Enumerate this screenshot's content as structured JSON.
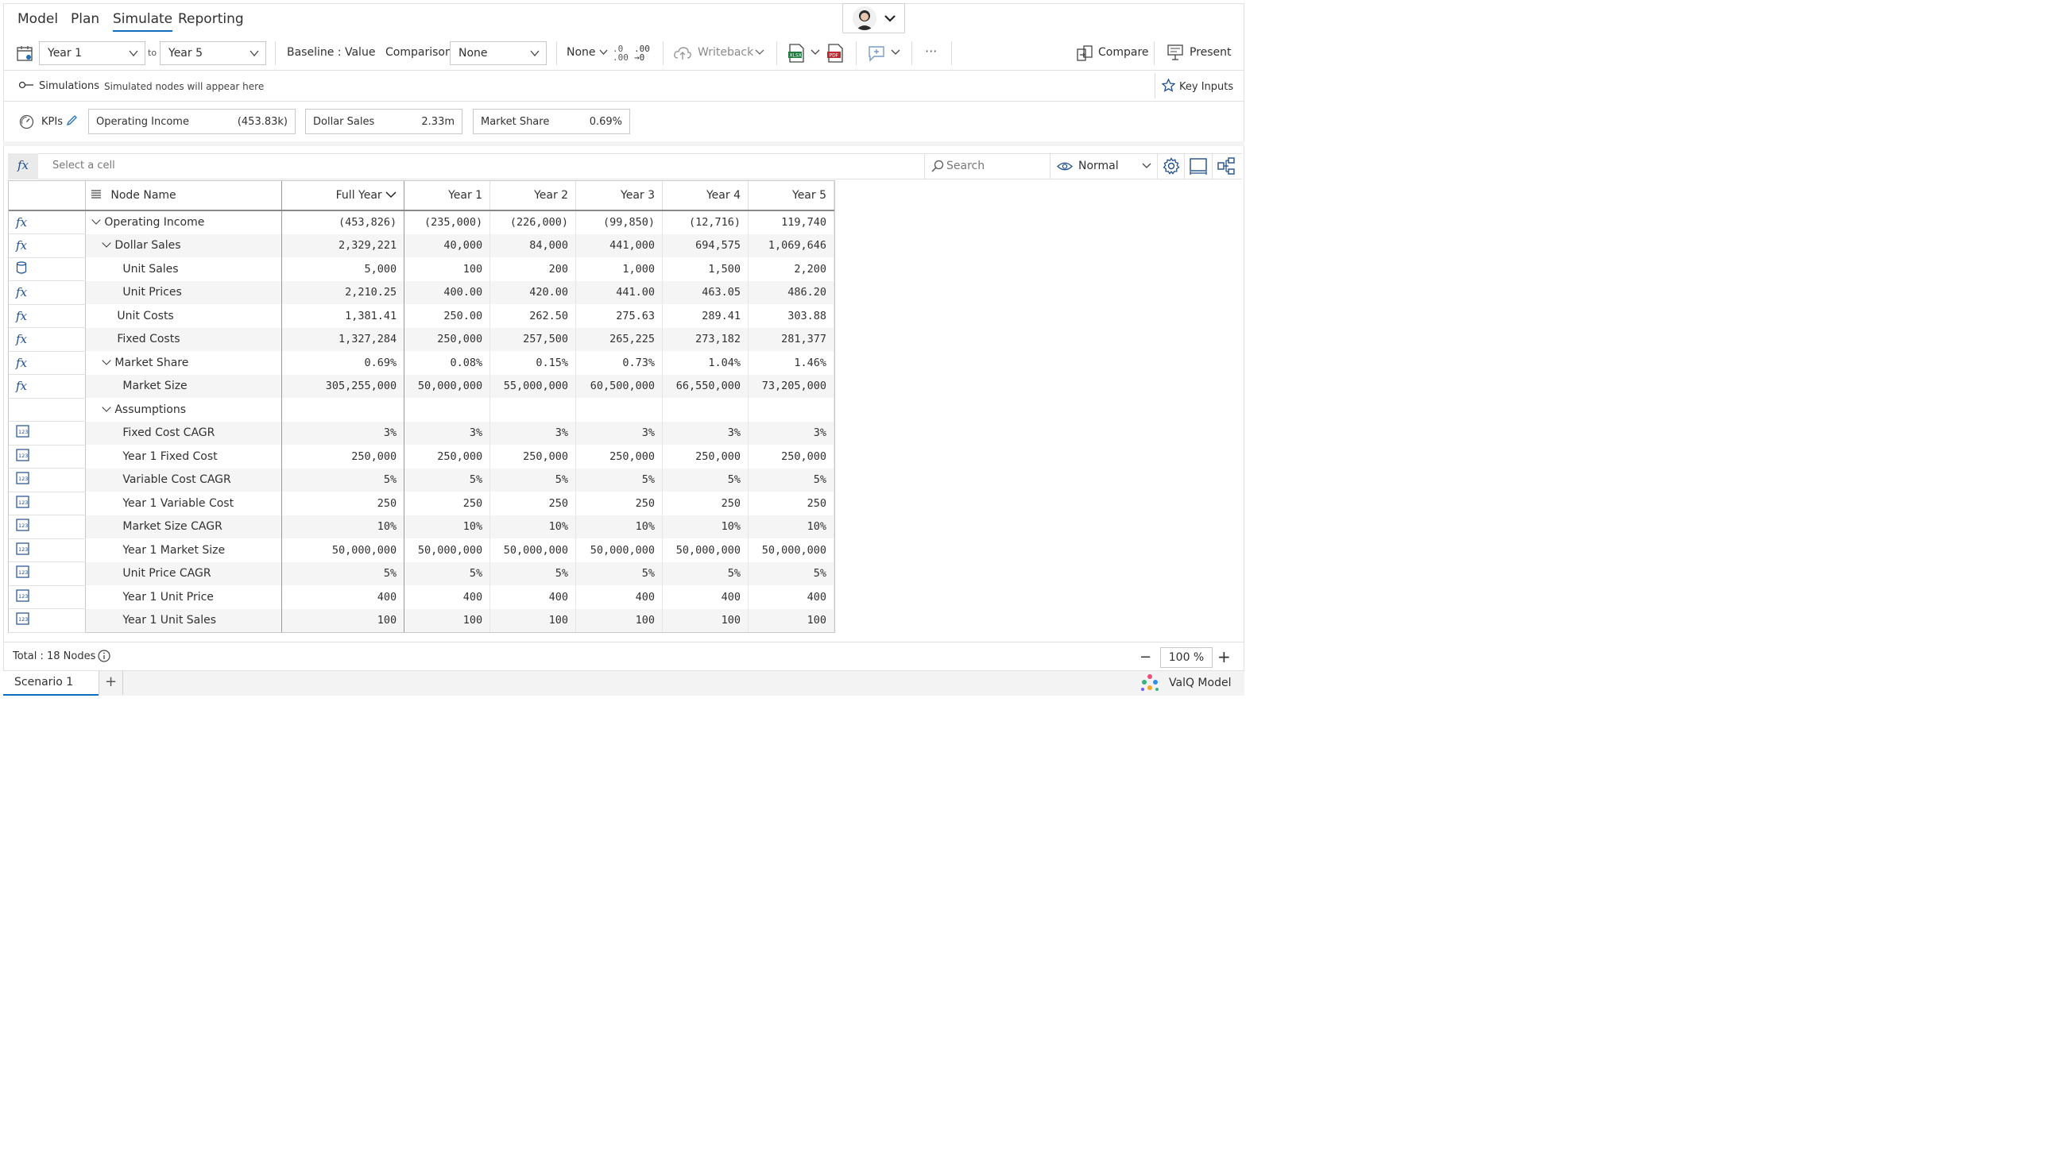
{
  "nav": {
    "tabs": [
      "Model",
      "Plan",
      "Simulate",
      "Reporting"
    ],
    "active": "Simulate"
  },
  "toolbar": {
    "from_year": "Year 1",
    "to_label": "to",
    "to_year": "Year 5",
    "baseline_label": "Baseline",
    "baseline_value": "Value",
    "comparison_label": "Comparison",
    "comparison_value": "None",
    "number_format": "None",
    "decimals_less": ".0",
    "decimals_more": ".00",
    "writeback_label": "Writeback",
    "more_label": "···",
    "compare_label": "Compare",
    "present_label": "Present"
  },
  "simulations": {
    "label": "Simulations",
    "hint": "Simulated nodes will appear here",
    "key_inputs_label": "Key Inputs"
  },
  "kpis": {
    "label": "KPIs",
    "cards": [
      {
        "name": "Operating Income",
        "value": "(453.83k)"
      },
      {
        "name": "Dollar Sales",
        "value": "2.33m"
      },
      {
        "name": "Market Share",
        "value": "0.69%"
      }
    ]
  },
  "formula_bar": {
    "fx": "fx",
    "placeholder": "Select a cell",
    "search_placeholder": "Search",
    "view_mode": "Normal"
  },
  "grid": {
    "node_name_header": "Node Name",
    "columns": [
      "Full Year",
      "Year 1",
      "Year 2",
      "Year 3",
      "Year 4",
      "Year 5"
    ],
    "rows": [
      {
        "icon": "fx",
        "name": "Operating Income",
        "indent": 0,
        "expand": true,
        "values": [
          "(453,826)",
          "(235,000)",
          "(226,000)",
          "(99,850)",
          "(12,716)",
          "119,740"
        ]
      },
      {
        "icon": "fx",
        "name": "Dollar Sales",
        "indent": 1,
        "expand": true,
        "values": [
          "2,329,221",
          "40,000",
          "84,000",
          "441,000",
          "694,575",
          "1,069,646"
        ]
      },
      {
        "icon": "db",
        "name": "Unit Sales",
        "indent": 2,
        "expand": false,
        "values": [
          "5,000",
          "100",
          "200",
          "1,000",
          "1,500",
          "2,200"
        ]
      },
      {
        "icon": "fx",
        "name": "Unit Prices",
        "indent": 2,
        "expand": false,
        "values": [
          "2,210.25",
          "400.00",
          "420.00",
          "441.00",
          "463.05",
          "486.20"
        ]
      },
      {
        "icon": "fx",
        "name": "Unit Costs",
        "indent": 1,
        "expand": false,
        "values": [
          "1,381.41",
          "250.00",
          "262.50",
          "275.63",
          "289.41",
          "303.88"
        ]
      },
      {
        "icon": "fx",
        "name": "Fixed Costs",
        "indent": 1,
        "expand": false,
        "values": [
          "1,327,284",
          "250,000",
          "257,500",
          "265,225",
          "273,182",
          "281,377"
        ]
      },
      {
        "icon": "fx",
        "name": "Market Share",
        "indent": 1,
        "expand": true,
        "values": [
          "0.69%",
          "0.08%",
          "0.15%",
          "0.73%",
          "1.04%",
          "1.46%"
        ]
      },
      {
        "icon": "fx",
        "name": "Market Size",
        "indent": 2,
        "expand": false,
        "values": [
          "305,255,000",
          "50,000,000",
          "55,000,000",
          "60,500,000",
          "66,550,000",
          "73,205,000"
        ]
      },
      {
        "icon": "none",
        "name": "Assumptions",
        "indent": 1,
        "expand": true,
        "values": [
          "",
          "",
          "",
          "",
          "",
          ""
        ]
      },
      {
        "icon": "123",
        "name": "Fixed Cost CAGR",
        "indent": 2,
        "expand": false,
        "values": [
          "3%",
          "3%",
          "3%",
          "3%",
          "3%",
          "3%"
        ]
      },
      {
        "icon": "123",
        "name": "Year 1 Fixed Cost",
        "indent": 2,
        "expand": false,
        "values": [
          "250,000",
          "250,000",
          "250,000",
          "250,000",
          "250,000",
          "250,000"
        ]
      },
      {
        "icon": "123",
        "name": "Variable Cost CAGR",
        "indent": 2,
        "expand": false,
        "values": [
          "5%",
          "5%",
          "5%",
          "5%",
          "5%",
          "5%"
        ]
      },
      {
        "icon": "123",
        "name": "Year 1 Variable Cost",
        "indent": 2,
        "expand": false,
        "values": [
          "250",
          "250",
          "250",
          "250",
          "250",
          "250"
        ]
      },
      {
        "icon": "123",
        "name": "Market Size CAGR",
        "indent": 2,
        "expand": false,
        "values": [
          "10%",
          "10%",
          "10%",
          "10%",
          "10%",
          "10%"
        ]
      },
      {
        "icon": "123",
        "name": "Year 1 Market Size",
        "indent": 2,
        "expand": false,
        "values": [
          "50,000,000",
          "50,000,000",
          "50,000,000",
          "50,000,000",
          "50,000,000",
          "50,000,000"
        ]
      },
      {
        "icon": "123",
        "name": "Unit Price CAGR",
        "indent": 2,
        "expand": false,
        "values": [
          "5%",
          "5%",
          "5%",
          "5%",
          "5%",
          "5%"
        ]
      },
      {
        "icon": "123",
        "name": "Year 1 Unit Price",
        "indent": 2,
        "expand": false,
        "values": [
          "400",
          "400",
          "400",
          "400",
          "400",
          "400"
        ]
      },
      {
        "icon": "123",
        "name": "Year 1 Unit Sales",
        "indent": 2,
        "expand": false,
        "values": [
          "100",
          "100",
          "100",
          "100",
          "100",
          "100"
        ]
      }
    ]
  },
  "footer": {
    "total_label": "Total : 18 Nodes",
    "zoom": "100 %",
    "scenario_tab": "Scenario 1",
    "brand": "ValQ Model"
  }
}
